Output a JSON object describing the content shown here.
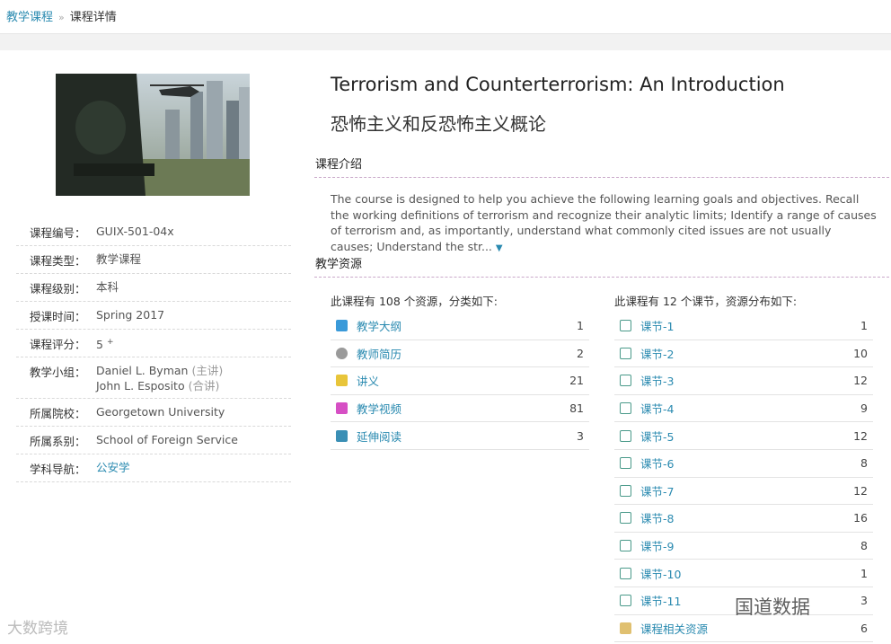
{
  "breadcrumb": {
    "parent": "教学课程",
    "separator": "»",
    "current": "课程详情"
  },
  "course": {
    "title_en": "Terrorism and Counterterrorism: An Introduction",
    "title_zh": "恐怖主义和反恐怖主义概论"
  },
  "info": [
    {
      "key": "课程编号：",
      "value": "GUIX-501-04x"
    },
    {
      "key": "课程类型：",
      "value": "教学课程"
    },
    {
      "key": "课程级别：",
      "value": "本科"
    },
    {
      "key": "授课时间：",
      "value": "Spring 2017"
    },
    {
      "key": "课程评分：",
      "value": "5",
      "sup": "+"
    },
    {
      "key": "教学小组：",
      "line1": "Daniel L. Byman",
      "note1": "(主讲)",
      "line2": "John L. Esposito",
      "note2": "(合讲)"
    },
    {
      "key": "所属院校：",
      "value": "Georgetown University"
    },
    {
      "key": "所属系别：",
      "value": "School of Foreign Service"
    },
    {
      "key": "学科导航：",
      "link": "公安学"
    }
  ],
  "intro": {
    "heading": "课程介绍",
    "text": "The course is designed to help you achieve the following learning goals and objectives. Recall the working definitions of terrorism and recognize their analytic limits; Identify a range of causes of terrorism and, as importantly, understand what commonly cited issues are not usually causes; Understand the str...",
    "more_icon": "triangle-down-icon"
  },
  "resources": {
    "heading": "教学资源",
    "by_type_title": "此课程有 108 个资源，分类如下:",
    "by_type": [
      {
        "label": "教学大纲",
        "count": "1",
        "icon": "syllabus-icon",
        "color": "#3a9ad9"
      },
      {
        "label": "教师简历",
        "count": "2",
        "icon": "profile-icon",
        "color": "#8a8a8a"
      },
      {
        "label": "讲义",
        "count": "21",
        "icon": "notes-icon",
        "color": "#e8c53a"
      },
      {
        "label": "教学视频",
        "count": "81",
        "icon": "video-icon",
        "color": "#d64fc4"
      },
      {
        "label": "延伸阅读",
        "count": "3",
        "icon": "book-icon",
        "color": "#3a8fb5"
      }
    ],
    "by_lesson_title": "此课程有 12 个课节，资源分布如下:",
    "by_lesson": [
      {
        "label": "课节-1",
        "count": "1",
        "icon": "lesson-book-icon"
      },
      {
        "label": "课节-2",
        "count": "10",
        "icon": "lesson-book-icon"
      },
      {
        "label": "课节-3",
        "count": "12",
        "icon": "lesson-book-icon"
      },
      {
        "label": "课节-4",
        "count": "9",
        "icon": "lesson-book-icon"
      },
      {
        "label": "课节-5",
        "count": "12",
        "icon": "lesson-book-icon"
      },
      {
        "label": "课节-6",
        "count": "8",
        "icon": "lesson-book-icon"
      },
      {
        "label": "课节-7",
        "count": "12",
        "icon": "lesson-book-icon"
      },
      {
        "label": "课节-8",
        "count": "16",
        "icon": "lesson-book-icon"
      },
      {
        "label": "课节-9",
        "count": "8",
        "icon": "lesson-book-icon"
      },
      {
        "label": "课节-10",
        "count": "1",
        "icon": "lesson-book-icon"
      },
      {
        "label": "课节-11",
        "count": "3",
        "icon": "lesson-book-icon"
      },
      {
        "label": "课程相关资源",
        "count": "6",
        "icon": "related-resources-icon"
      }
    ]
  },
  "watermarks": {
    "left": "大数跨境",
    "right": "国道数据"
  }
}
